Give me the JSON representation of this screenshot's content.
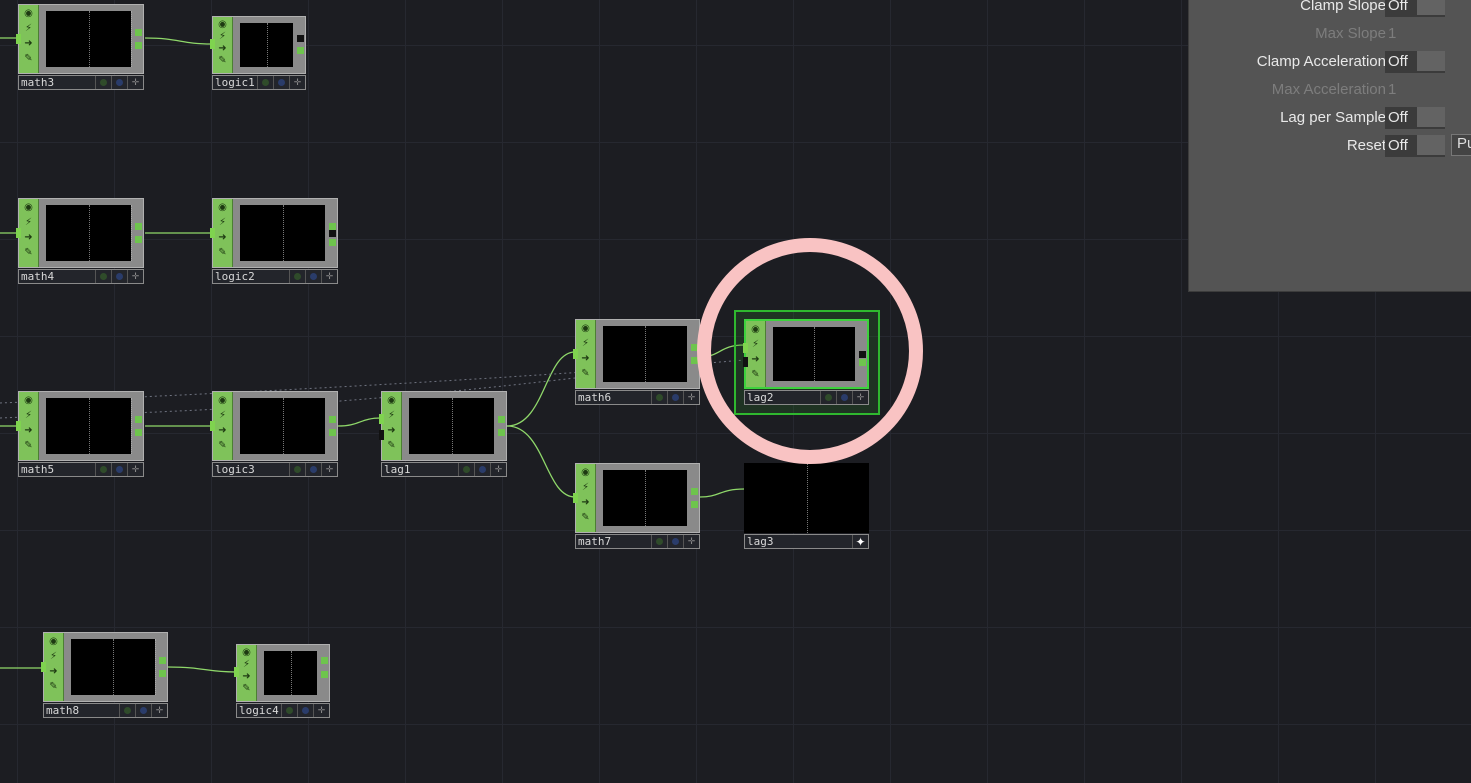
{
  "nodes": {
    "math3": "math3",
    "logic1": "logic1",
    "math4": "math4",
    "logic2": "logic2",
    "math5": "math5",
    "logic3": "logic3",
    "lag1": "lag1",
    "math6": "math6",
    "lag2": "lag2",
    "math7": "math7",
    "lag3": "lag3",
    "math8": "math8",
    "logic4": "logic4"
  },
  "selected_node": "lag2",
  "params": {
    "rows": [
      {
        "label": "Clamp Slope",
        "value": "Off"
      },
      {
        "label": "Max Slope",
        "value": "1"
      },
      {
        "label": "Clamp Acceleration",
        "value": "Off"
      },
      {
        "label": "Max Acceleration",
        "value": "1"
      },
      {
        "label": "Lag per Sample",
        "value": "Off"
      },
      {
        "label": "Reset",
        "value": "Off",
        "pulse": "Pu"
      }
    ]
  },
  "colors": {
    "background": "#1c1d22",
    "node_strip": "#7fc25a",
    "wire": "#8fd86a",
    "selection": "#2fb82f",
    "highlight_ring": "#f9c3c3"
  }
}
